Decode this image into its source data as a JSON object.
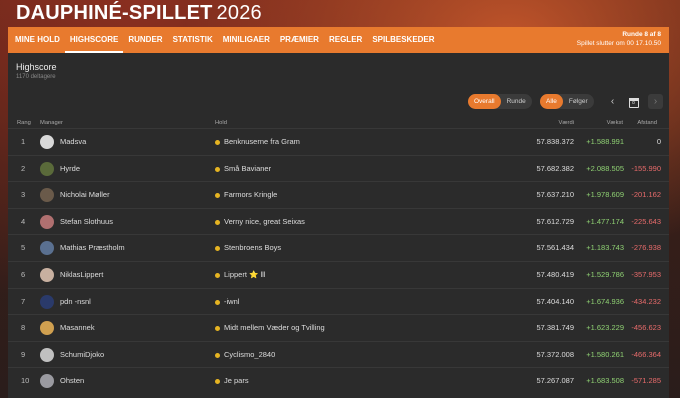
{
  "brand": {
    "name": "DAUPHINÉ-SPILLET",
    "year": "2026"
  },
  "nav": {
    "items": [
      "MINE HOLD",
      "HIGHSCORE",
      "RUNDER",
      "STATISTIK",
      "MINILIGAER",
      "PRÆMIER",
      "REGLER",
      "SPILBESKEDER"
    ],
    "active_index": 1
  },
  "round_info": {
    "line1": "Runde 8 af 8",
    "line2": "Spillet slutter om 00 17.10.50"
  },
  "header": {
    "title": "Highscore",
    "subtitle": "1170 deltagere"
  },
  "toggle1": {
    "options": [
      "Overall",
      "Runde"
    ],
    "selected": "Overall"
  },
  "toggle2": {
    "options": [
      "Alle",
      "Følger"
    ],
    "selected": "Alle"
  },
  "controls": {
    "prev": "‹",
    "next": "›",
    "calendar_label": "8"
  },
  "columns": {
    "rank": "Rang",
    "manager": "Manager",
    "team": "Hold",
    "value": "Værdi",
    "growth": "Vækst",
    "distance": "Afstand"
  },
  "rows": [
    {
      "rank": "1",
      "manager": "Madsva",
      "team": "Benknuserne fra Gram",
      "value": "57.838.372",
      "growth": "+1.588.991",
      "distance": "0",
      "avatar_color": "#d8d8d8"
    },
    {
      "rank": "2",
      "manager": "Hyrde",
      "team": "Små Bavianer",
      "value": "57.682.382",
      "growth": "+2.088.505",
      "distance": "-155.990",
      "avatar_color": "#5a6a3a"
    },
    {
      "rank": "3",
      "manager": "Nicholai Møller",
      "team": "Farmors Kringle",
      "value": "57.637.210",
      "growth": "+1.978.609",
      "distance": "-201.162",
      "avatar_color": "#6a5a4a"
    },
    {
      "rank": "4",
      "manager": "Stefan Slothuus",
      "team": "Verny nice, great Seixas",
      "value": "57.612.729",
      "growth": "+1.477.174",
      "distance": "-225.643",
      "avatar_color": "#b07070"
    },
    {
      "rank": "5",
      "manager": "Mathias Præstholm",
      "team": "Stenbroens Boys",
      "value": "57.561.434",
      "growth": "+1.183.743",
      "distance": "-276.938",
      "avatar_color": "#5a7090"
    },
    {
      "rank": "6",
      "manager": "NiklasLippert",
      "team": "Lippert ⭐ lll",
      "value": "57.480.419",
      "growth": "+1.529.786",
      "distance": "-357.953",
      "avatar_color": "#c8b0a0"
    },
    {
      "rank": "7",
      "manager": "pdn -nsnl",
      "team": "-iwnl",
      "value": "57.404.140",
      "growth": "+1.674.936",
      "distance": "-434.232",
      "avatar_color": "#2a3a6a"
    },
    {
      "rank": "8",
      "manager": "Masannek",
      "team": "Midt mellem Væder og Tvilling",
      "value": "57.381.749",
      "growth": "+1.623.229",
      "distance": "-456.623",
      "avatar_color": "#d0a050"
    },
    {
      "rank": "9",
      "manager": "SchumiDjoko",
      "team": "Cyclismo_2840",
      "value": "57.372.008",
      "growth": "+1.580.261",
      "distance": "-466.364",
      "avatar_color": "#c0c0c0"
    },
    {
      "rank": "10",
      "manager": "Ohsten",
      "team": "Je pars",
      "value": "57.267.087",
      "growth": "+1.683.508",
      "distance": "-571.285",
      "avatar_color": "#9a9aa0"
    }
  ]
}
